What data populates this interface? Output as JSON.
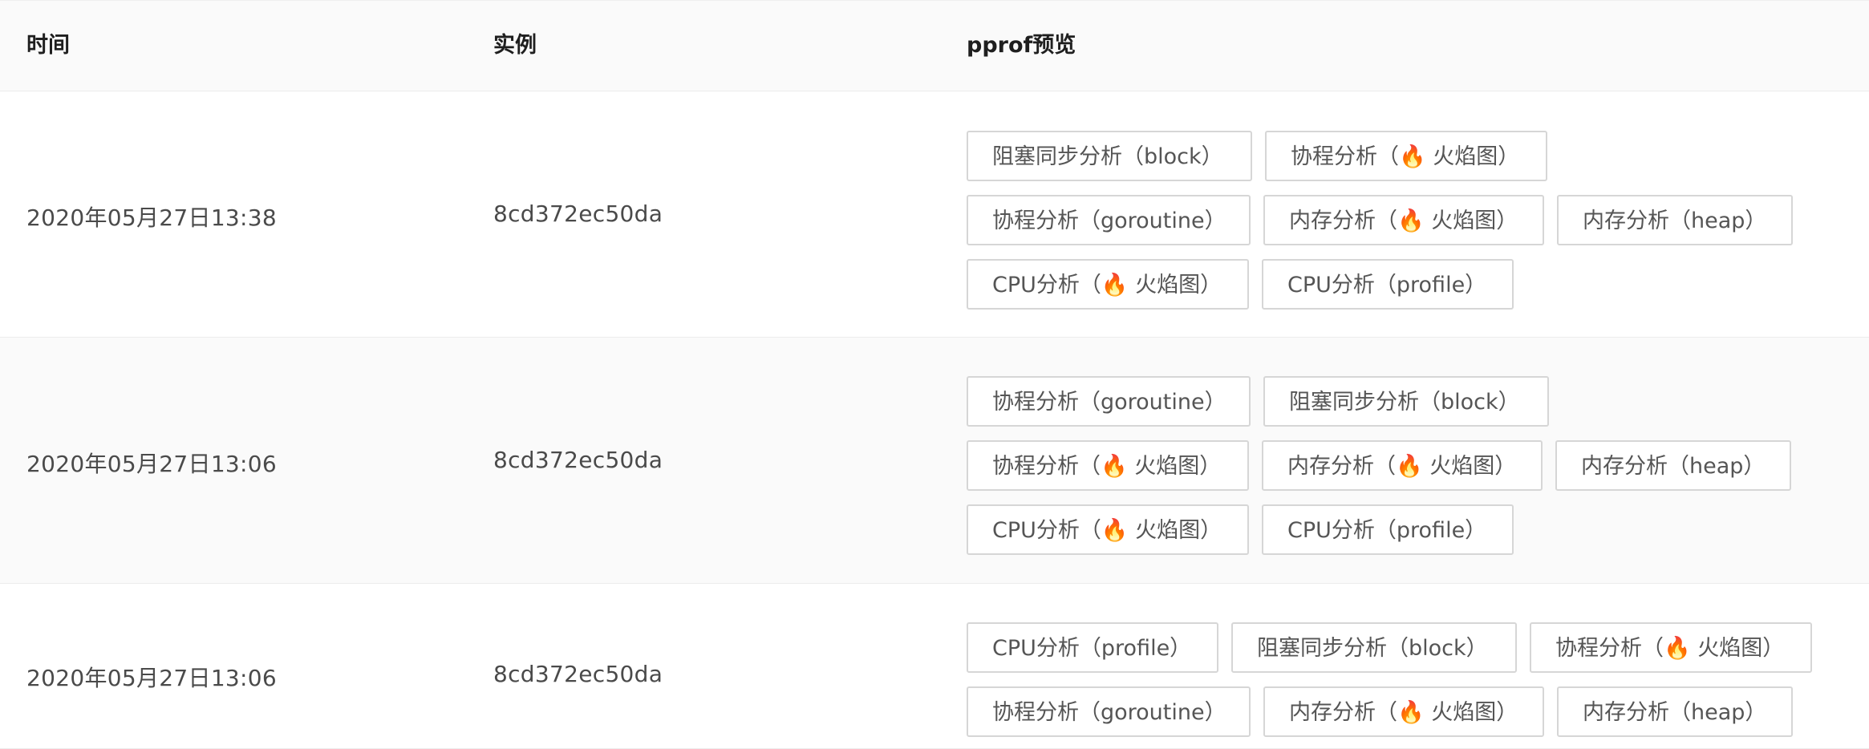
{
  "header": {
    "time": "时间",
    "instance": "实例",
    "pprof": "pprof预览"
  },
  "labels": {
    "block": "阻塞同步分析（block）",
    "goroutine_flame": "协程分析（🔥 火焰图）",
    "goroutine": "协程分析（goroutine）",
    "heap_flame": "内存分析（🔥 火焰图）",
    "heap": "内存分析（heap）",
    "cpu_flame": "CPU分析（🔥 火焰图）",
    "cpu_profile": "CPU分析（profile）"
  },
  "rows": [
    {
      "time": "2020年05月27日13:38",
      "instance": "8cd372ec50da",
      "buttons": [
        "阻塞同步分析（block）",
        "协程分析（🔥 火焰图）",
        "协程分析（goroutine）",
        "内存分析（🔥 火焰图）",
        "内存分析（heap）",
        "CPU分析（🔥 火焰图）",
        "CPU分析（profile）"
      ]
    },
    {
      "time": "2020年05月27日13:06",
      "instance": "8cd372ec50da",
      "buttons": [
        "协程分析（goroutine）",
        "阻塞同步分析（block）",
        "协程分析（🔥 火焰图）",
        "内存分析（🔥 火焰图）",
        "内存分析（heap）",
        "CPU分析（🔥 火焰图）",
        "CPU分析（profile）"
      ]
    },
    {
      "time": "2020年05月27日13:06",
      "instance": "8cd372ec50da",
      "buttons": [
        "CPU分析（profile）",
        "阻塞同步分析（block）",
        "协程分析（🔥 火焰图）",
        "协程分析（goroutine）",
        "内存分析（🔥 火焰图）",
        "内存分析（heap）"
      ]
    }
  ]
}
